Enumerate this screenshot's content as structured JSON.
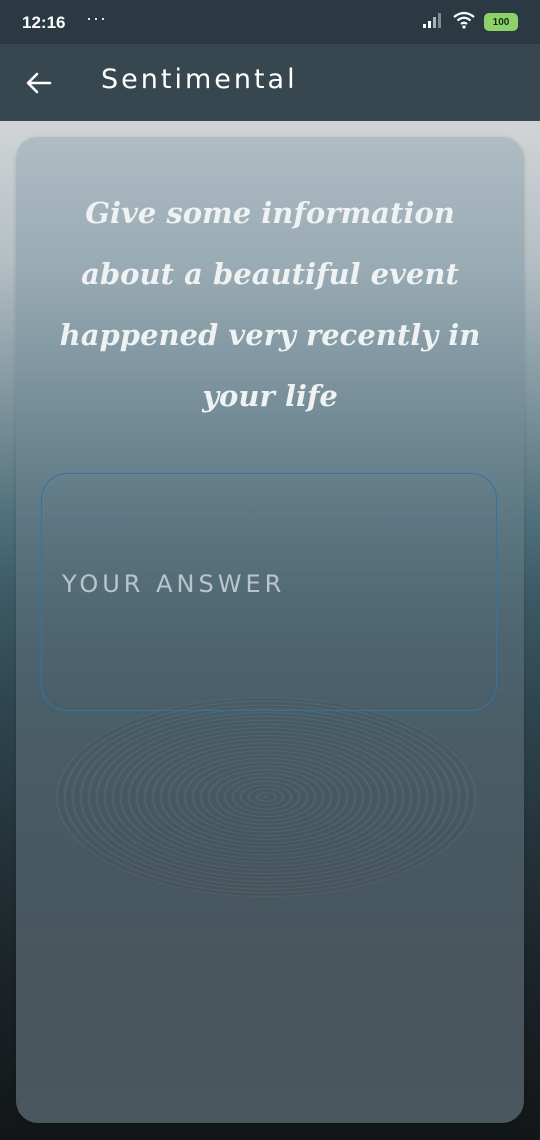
{
  "status_bar": {
    "time": "12:16",
    "dots": "···",
    "battery": "100"
  },
  "app_bar": {
    "title": "Sentimental"
  },
  "card": {
    "question": "Give some information about a beautiful event happened very recently in your life",
    "answer_value": "",
    "answer_placeholder": "YOUR ANSWER"
  },
  "colors": {
    "status_bar_bg": "#2b3a42",
    "app_bar_bg": "#37474f",
    "input_border": "#3a6fa8",
    "battery": "#8dd16a"
  }
}
